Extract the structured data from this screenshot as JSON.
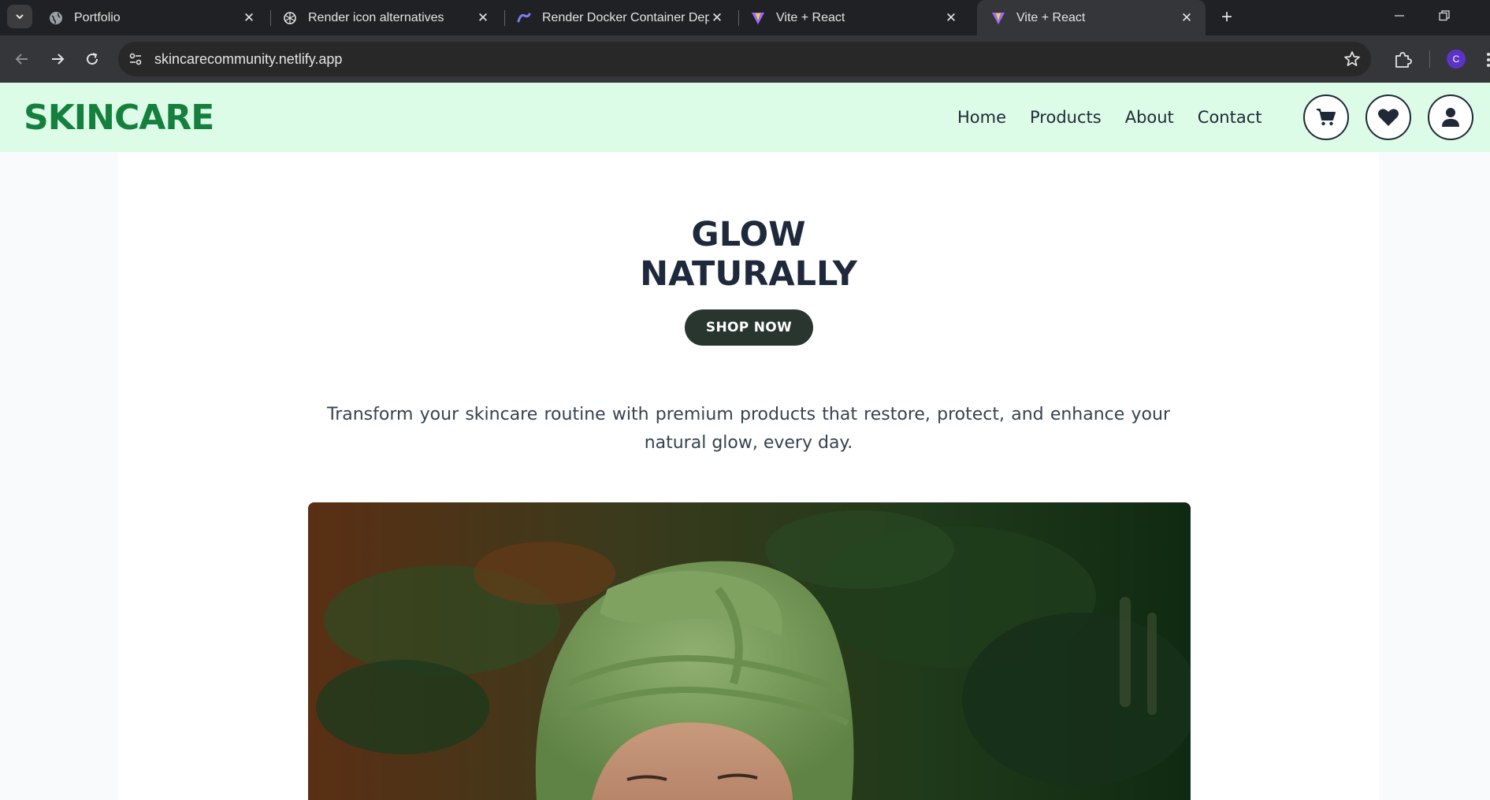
{
  "browser": {
    "tabs": [
      {
        "title": "Portfolio",
        "icon": "globe-icon",
        "active": false
      },
      {
        "title": "Render icon alternatives",
        "icon": "openai-icon",
        "active": false
      },
      {
        "title": "Render Docker Container Deplo",
        "icon": "render-icon",
        "active": false
      },
      {
        "title": "Vite + React",
        "icon": "vite-icon",
        "active": false
      },
      {
        "title": "Vite + React",
        "icon": "vite-icon",
        "active": true
      }
    ],
    "url": "skincarecommunity.netlify.app",
    "profile_initial": "C"
  },
  "site": {
    "logo": "SKINCARE",
    "nav": [
      "Home",
      "Products",
      "About",
      "Contact"
    ],
    "icons": [
      "cart-icon",
      "heart-icon",
      "user-icon"
    ],
    "hero": {
      "title_line1": "GLOW",
      "title_line2": "NATURALLY",
      "cta": "SHOP NOW",
      "description": "Transform your skincare routine with premium products that restore, protect, and enhance your natural glow, every day."
    }
  },
  "colors": {
    "header_bg": "#dcfce7",
    "logo": "#15803d",
    "cta_bg": "#28362f",
    "heading": "#1e293b"
  }
}
